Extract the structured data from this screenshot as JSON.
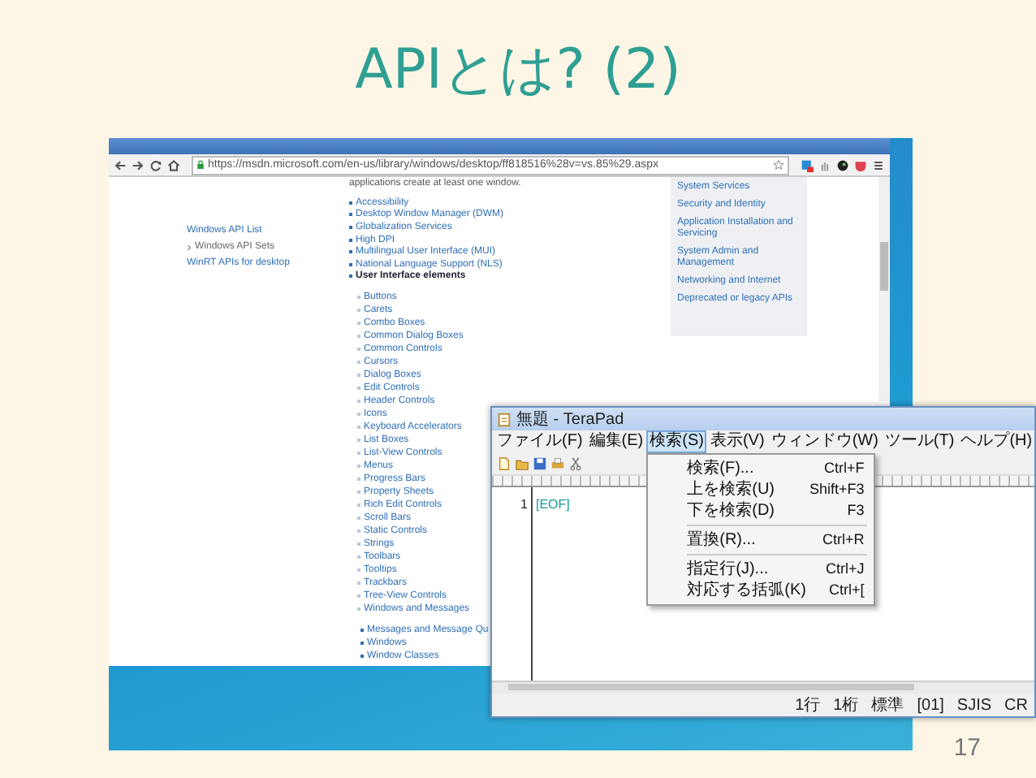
{
  "slide": {
    "title": "APIとは? (2)",
    "page_number": "17"
  },
  "browser": {
    "url": "https://msdn.microsoft.com/en-us/library/windows/desktop/ff818516%28v=vs.85%29.aspx",
    "intro_text": "applications create at least one window.",
    "side_nav": [
      {
        "label": "Windows API List",
        "selected": false
      },
      {
        "label": "Windows API Sets",
        "selected": true
      },
      {
        "label": "WinRT APIs for desktop",
        "selected": false
      }
    ],
    "topics": [
      {
        "label": "Accessibility",
        "expanded": false
      },
      {
        "label": "Desktop Window Manager (DWM)",
        "expanded": false
      },
      {
        "label": "Globalization Services",
        "expanded": false
      },
      {
        "label": "High DPI",
        "expanded": false
      },
      {
        "label": "Multilingual User Interface (MUI)",
        "expanded": false
      },
      {
        "label": "National Language Support (NLS)",
        "expanded": false
      },
      {
        "label": "User Interface elements",
        "expanded": true,
        "children": [
          {
            "label": "Buttons",
            "expanded": false
          },
          {
            "label": "Carets",
            "expanded": false
          },
          {
            "label": "Combo Boxes",
            "expanded": false
          },
          {
            "label": "Common Dialog Boxes",
            "expanded": false
          },
          {
            "label": "Common Controls",
            "expanded": false
          },
          {
            "label": "Cursors",
            "expanded": false
          },
          {
            "label": "Dialog Boxes",
            "expanded": false
          },
          {
            "label": "Edit Controls",
            "expanded": false
          },
          {
            "label": "Header Controls",
            "expanded": false
          },
          {
            "label": "Icons",
            "expanded": false
          },
          {
            "label": "Keyboard Accelerators",
            "expanded": false
          },
          {
            "label": "List Boxes",
            "expanded": false
          },
          {
            "label": "List-View Controls",
            "expanded": false
          },
          {
            "label": "Menus",
            "expanded": false
          },
          {
            "label": "Progress Bars",
            "expanded": false
          },
          {
            "label": "Property Sheets",
            "expanded": false
          },
          {
            "label": "Rich Edit Controls",
            "expanded": false
          },
          {
            "label": "Scroll Bars",
            "expanded": false
          },
          {
            "label": "Static Controls",
            "expanded": false
          },
          {
            "label": "Strings",
            "expanded": false
          },
          {
            "label": "Toolbars",
            "expanded": false
          },
          {
            "label": "Tooltips",
            "expanded": false
          },
          {
            "label": "Trackbars",
            "expanded": false
          },
          {
            "label": "Tree-View Controls",
            "expanded": false
          },
          {
            "label": "Windows and Messages",
            "expanded": true,
            "children": [
              {
                "label": "Messages and Message Qu"
              },
              {
                "label": "Windows"
              },
              {
                "label": "Window Classes"
              }
            ]
          }
        ]
      }
    ],
    "related_links": [
      "System Services",
      "Security and Identity",
      "Application Installation and Servicing",
      "System Admin and Management",
      "Networking and Internet",
      "Deprecated or legacy APIs"
    ]
  },
  "terapad": {
    "title": "無題 - TeraPad",
    "menus": [
      {
        "label": "ファイル(F)",
        "selected": false
      },
      {
        "label": "編集(E)",
        "selected": false
      },
      {
        "label": "検索(S)",
        "selected": true
      },
      {
        "label": "表示(V)",
        "selected": false
      },
      {
        "label": "ウィンドウ(W)",
        "selected": false
      },
      {
        "label": "ツール(T)",
        "selected": false
      },
      {
        "label": "ヘルプ(H)",
        "selected": false
      }
    ],
    "dropdown": [
      {
        "label": "検索(F)...",
        "shortcut": "Ctrl+F",
        "separator_before": false
      },
      {
        "label": "上を検索(U)",
        "shortcut": "Shift+F3",
        "separator_before": false
      },
      {
        "label": "下を検索(D)",
        "shortcut": "F3",
        "separator_before": false
      },
      {
        "label": "置換(R)...",
        "shortcut": "Ctrl+R",
        "separator_before": true
      },
      {
        "label": "指定行(J)...",
        "shortcut": "Ctrl+J",
        "separator_before": true
      },
      {
        "label": "対応する括弧(K)",
        "shortcut": "Ctrl+[",
        "separator_before": false
      }
    ],
    "line_number": "1",
    "eof_mark": "[EOF]",
    "status": [
      "1行",
      "1桁",
      "標準",
      "[01]",
      "SJIS",
      "CR"
    ]
  }
}
